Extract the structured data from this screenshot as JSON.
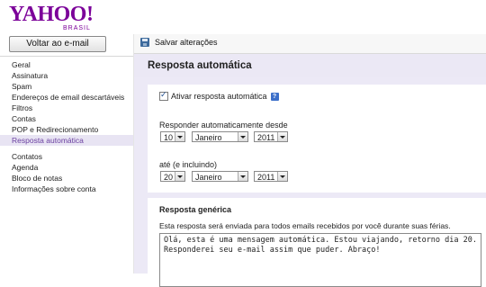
{
  "brand": {
    "logo_text": "YAHOO!",
    "logo_sub": "BRASIL"
  },
  "sidebar": {
    "back_button": "Voltar ao e-mail",
    "items": [
      {
        "label": "Geral"
      },
      {
        "label": "Assinatura"
      },
      {
        "label": "Spam"
      },
      {
        "label": "Endereços de email descartáveis"
      },
      {
        "label": "Filtros"
      },
      {
        "label": "Contas"
      },
      {
        "label": "POP e Redirecionamento"
      },
      {
        "label": "Resposta automática",
        "active": true
      },
      {
        "label": "Contatos"
      },
      {
        "label": "Agenda"
      },
      {
        "label": "Bloco de notas"
      },
      {
        "label": "Informações sobre conta"
      }
    ]
  },
  "toolbar": {
    "save_label": "Salvar alterações",
    "save_icon": "floppy-disk-icon"
  },
  "page": {
    "title": "Resposta automática"
  },
  "autoreply": {
    "enable_label": "Ativar resposta automática",
    "enabled": true,
    "help_icon": "help-icon",
    "from_label": "Responder automaticamente desde",
    "from": {
      "day": "10",
      "month": "Janeiro",
      "year": "2011"
    },
    "until_label": "até (e incluindo)",
    "until": {
      "day": "20",
      "month": "Janeiro",
      "year": "2011"
    }
  },
  "generic": {
    "title": "Resposta genérica",
    "description": "Esta resposta será enviada para todos emails recebidos por você durante suas férias.",
    "message": "Olá, esta é uma mensagem automática. Estou viajando, retorno dia 20. Responderei seu e-mail assim que puder. Abraço!"
  },
  "colors": {
    "brand": "#7b0099",
    "active_bg": "#e8e4f3",
    "panel_bg": "#ece9f6"
  }
}
